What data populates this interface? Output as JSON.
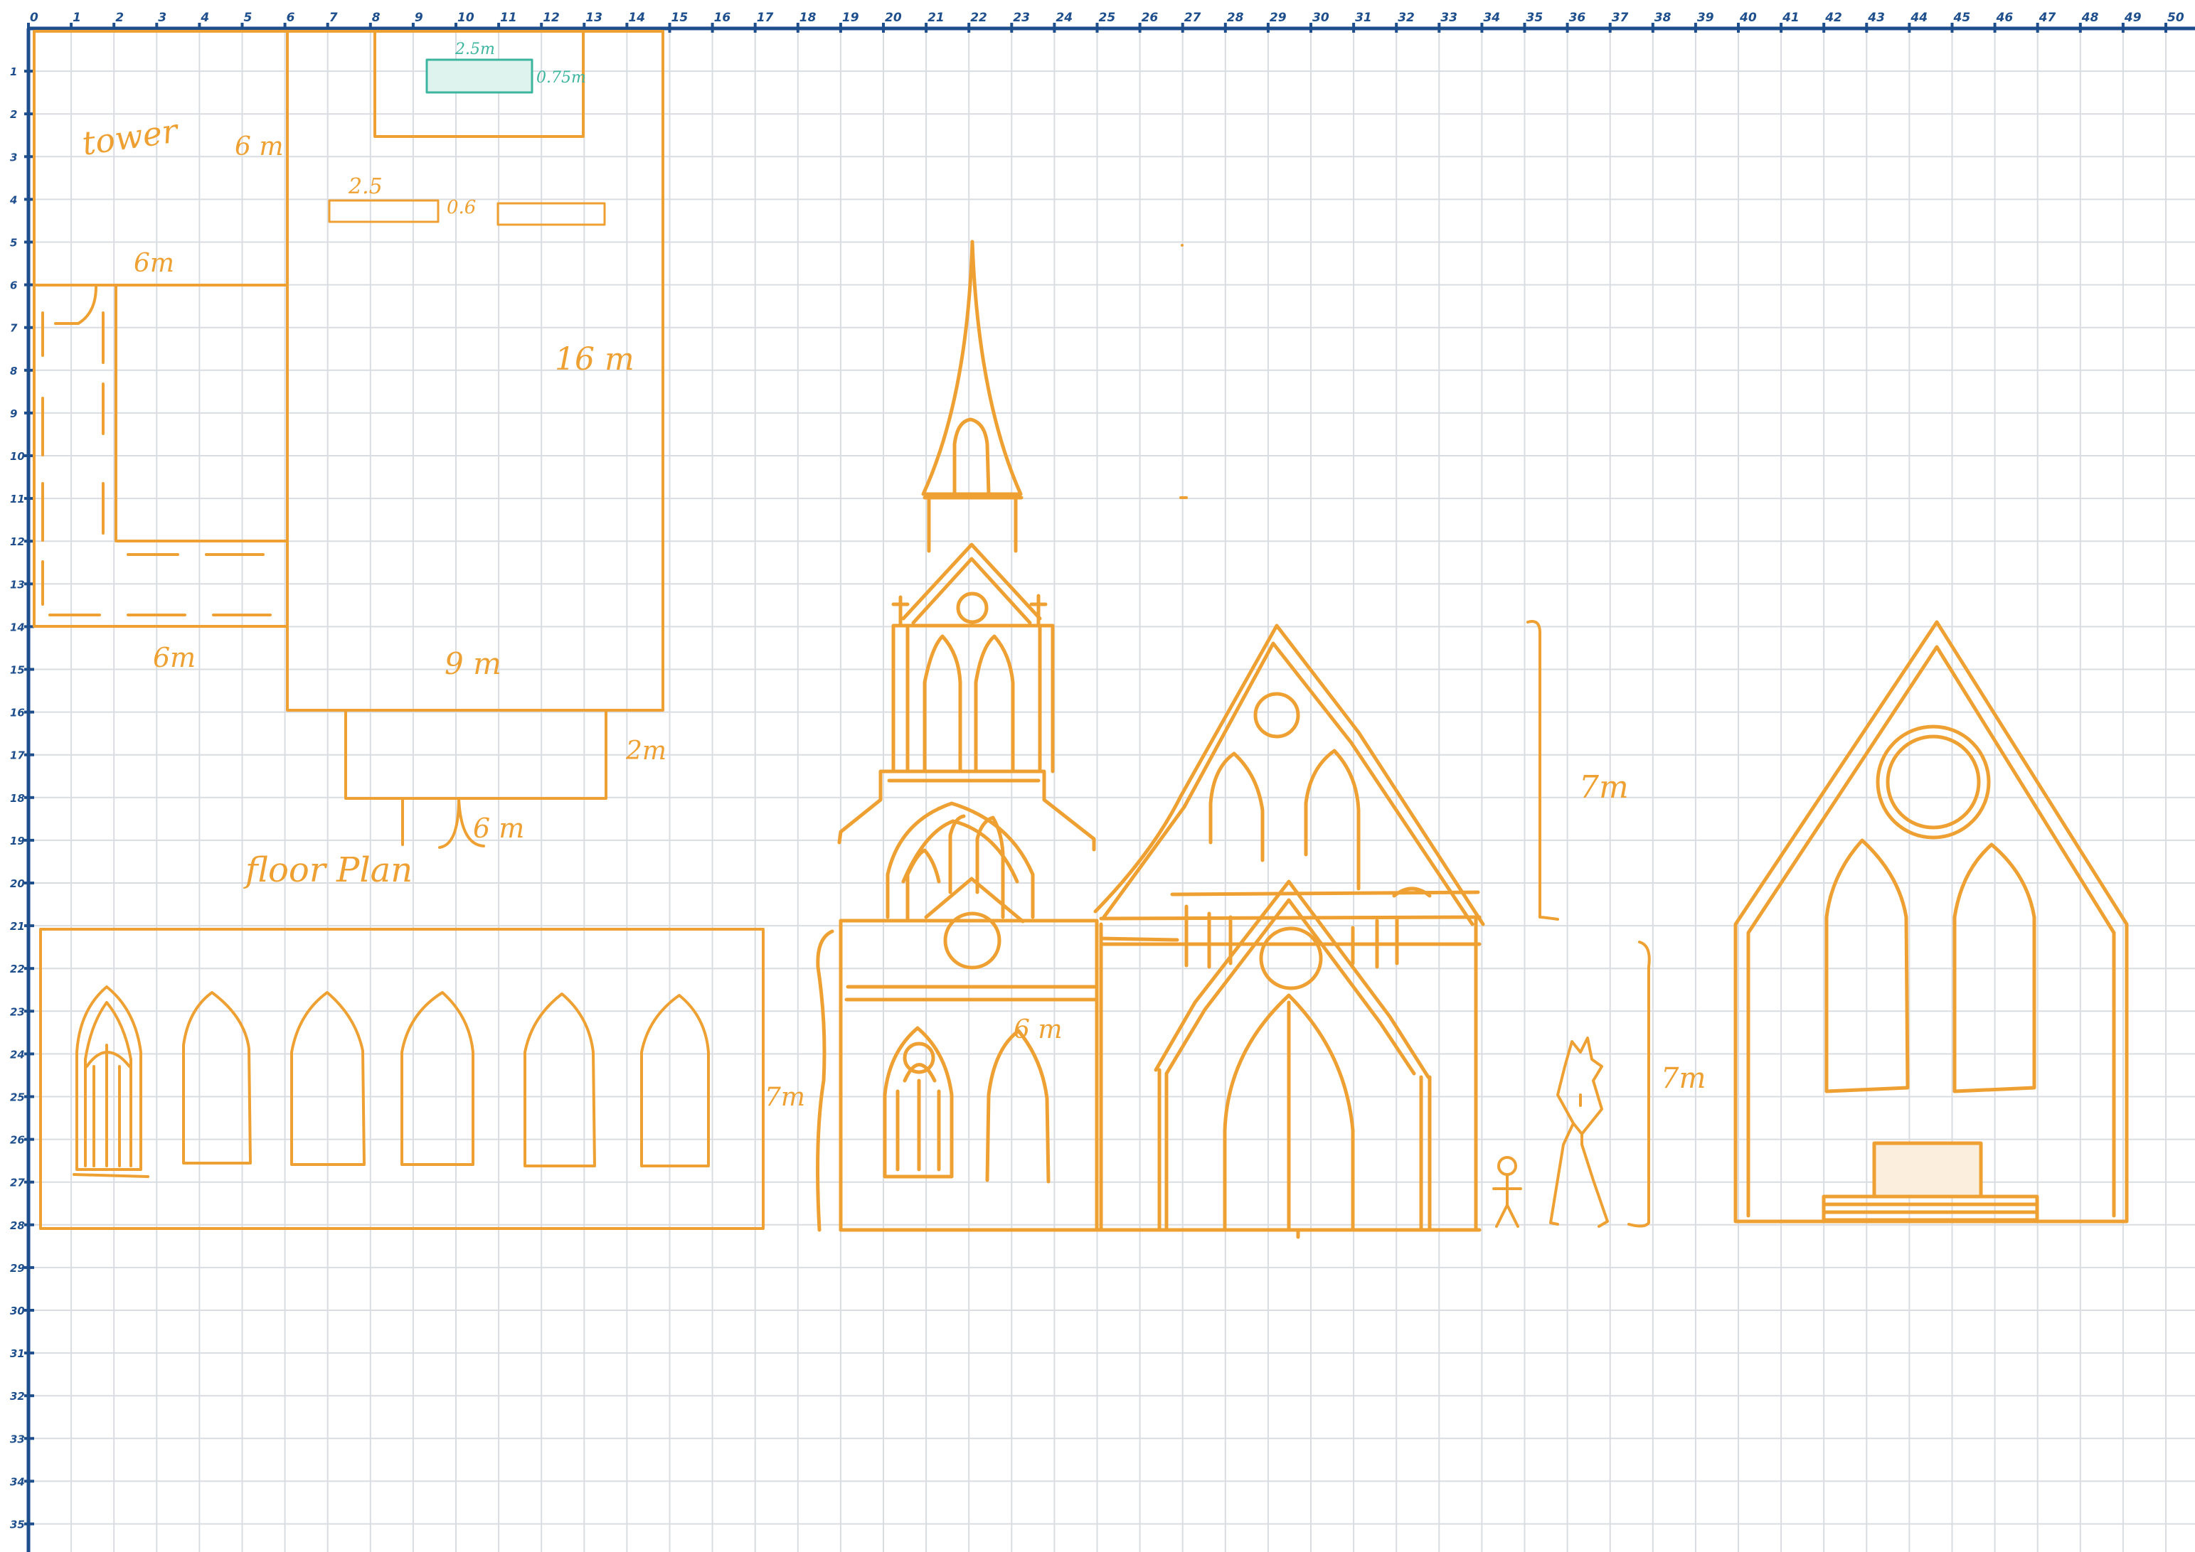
{
  "colors": {
    "ink": "#eea132",
    "teal": "#3cb59f",
    "teal_fill": "#dff3ee",
    "grid": "#d9dde2",
    "axis": "#1e4f8c",
    "paper": "#ffffff",
    "platform_fill": "#fbeedd"
  },
  "ruler": {
    "top_labels": [
      "0",
      "1",
      "2",
      "3",
      "4",
      "5",
      "6",
      "7",
      "8",
      "9",
      "10",
      "11",
      "12",
      "13",
      "14",
      "15",
      "16",
      "17",
      "18",
      "19",
      "20",
      "21",
      "22",
      "23",
      "24",
      "25",
      "26",
      "27",
      "28",
      "29",
      "30",
      "31",
      "32",
      "33",
      "34",
      "35",
      "36",
      "37",
      "38",
      "39",
      "40",
      "41",
      "42",
      "43",
      "44",
      "45",
      "46",
      "47",
      "48",
      "49",
      "50"
    ],
    "left_labels": [
      "1",
      "2",
      "3",
      "4",
      "5",
      "6",
      "7",
      "8",
      "9",
      "10",
      "11",
      "12",
      "13",
      "14",
      "15",
      "16",
      "17",
      "18",
      "19",
      "20",
      "21",
      "22",
      "23",
      "24",
      "25",
      "26",
      "27",
      "28",
      "29",
      "30",
      "31",
      "32",
      "33",
      "34",
      "35"
    ]
  },
  "floor_plan": {
    "title": "floor Plan",
    "tower_label": "tower",
    "tower_height": "6 m",
    "tower_width": "6m",
    "aisle_width": "6m",
    "nave_length": "16 m",
    "nave_width": "9 m",
    "porch_depth": "2m",
    "steps_width": "6 m",
    "altar_width": "2.5m",
    "altar_depth": "0.75m",
    "pew_length": "2.5",
    "pew_gap": "0.6"
  },
  "elevations": {
    "side_height": "7m",
    "tower_level": "6 m",
    "gable_height": "7m",
    "figure_height": "7m"
  }
}
